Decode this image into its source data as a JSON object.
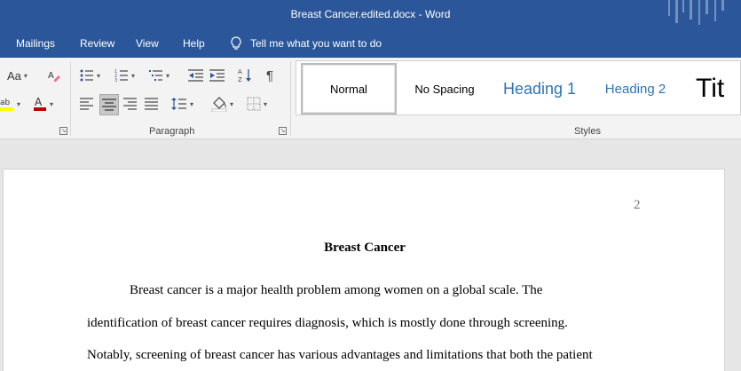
{
  "window": {
    "title": "Breast Cancer.edited.docx  -  Word"
  },
  "menu": {
    "items": [
      "Mailings",
      "Review",
      "View",
      "Help"
    ],
    "tell_me": "Tell me what you want to do"
  },
  "ribbon": {
    "font_group": {
      "change_case": "Aa"
    },
    "paragraph_group": {
      "label": "Paragraph"
    },
    "styles_group": {
      "label": "Styles",
      "tiles": [
        "Normal",
        "No Spacing",
        "Heading 1",
        "Heading 2",
        "Tit"
      ],
      "heading_color": "#2e74b5"
    }
  },
  "document": {
    "page_number": "2",
    "title": "Breast Cancer",
    "lines": [
      "Breast cancer is a major health problem among women on a global scale. The",
      "identification of breast cancer requires diagnosis, which is mostly done through screening.",
      "Notably, screening of breast cancer has various advantages and limitations that both the patient"
    ]
  },
  "colors": {
    "titlebar": "#2b579a",
    "ribbon": "#f3f3f3",
    "font_color_red": "#c00000",
    "highlight_yellow": "#ffff00"
  }
}
